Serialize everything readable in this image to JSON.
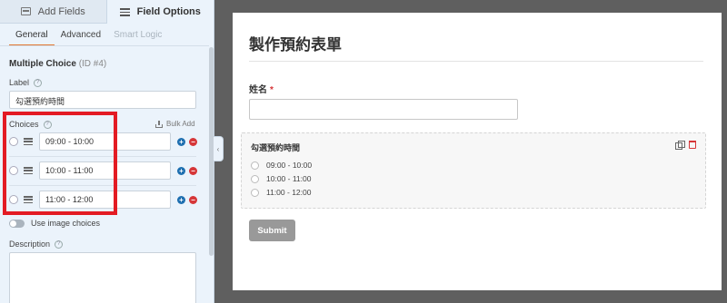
{
  "tabs": {
    "add_fields": "Add Fields",
    "field_options": "Field Options"
  },
  "sub_tabs": {
    "general": "General",
    "advanced": "Advanced",
    "smart_logic": "Smart Logic"
  },
  "field": {
    "type": "Multiple Choice",
    "id_label": "(ID #4)"
  },
  "label_section": {
    "label": "Label",
    "value": "勾選預約時間"
  },
  "choices_section": {
    "label": "Choices",
    "bulk_add": "Bulk Add",
    "items": [
      "09:00 - 10:00",
      "10:00 - 11:00",
      "11:00 - 12:00"
    ]
  },
  "image_choices": {
    "label": "Use image choices"
  },
  "description": {
    "label": "Description"
  },
  "highlight_color": "#e31b23",
  "icons": {
    "add_fields": "fields-icon",
    "field_options": "sliders-icon",
    "help": "help-circle-icon",
    "bulk_add": "download-icon",
    "drag": "drag-handle-icon",
    "add": "plus-circle-icon",
    "remove": "minus-circle-icon",
    "duplicate": "duplicate-icon",
    "delete": "trash-icon",
    "collapse": "chevron-left-icon"
  },
  "preview": {
    "form_title": "製作預約表單",
    "name_field": {
      "label": "姓名",
      "required_mark": "*"
    },
    "choice_field": {
      "label": "勾選預約時間",
      "options": [
        "09:00 - 10:00",
        "10:00 - 11:00",
        "11:00 - 12:00"
      ]
    },
    "submit_label": "Submit"
  }
}
